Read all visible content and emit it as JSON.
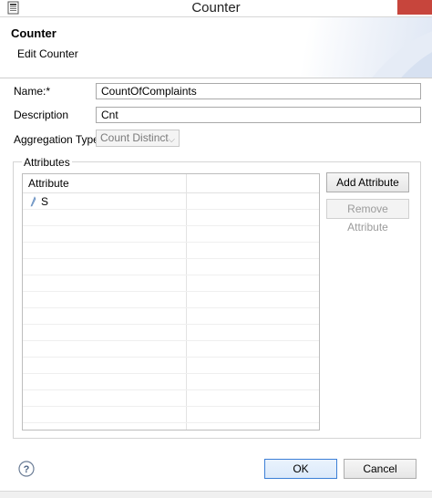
{
  "window": {
    "title": "Counter"
  },
  "banner": {
    "title": "Counter",
    "subtitle": "Edit Counter"
  },
  "form": {
    "name_label": "Name:*",
    "name_value": "CountOfComplaints",
    "description_label": "Description",
    "description_value": "Cnt",
    "aggregation_label": "Aggregation Type",
    "aggregation_value": "Count Distinct"
  },
  "attributes": {
    "group_label": "Attributes",
    "column_header": "Attribute",
    "rows": [
      {
        "name": "S"
      }
    ],
    "add_label": "Add Attribute",
    "remove_label": "Remove Attribute"
  },
  "footer": {
    "ok_label": "OK",
    "cancel_label": "Cancel"
  },
  "icons": {
    "help": "help-icon",
    "attribute": "attribute-icon",
    "window": "window-icon"
  },
  "colors": {
    "accent": "#3c7fd6",
    "close": "#c7453c"
  }
}
